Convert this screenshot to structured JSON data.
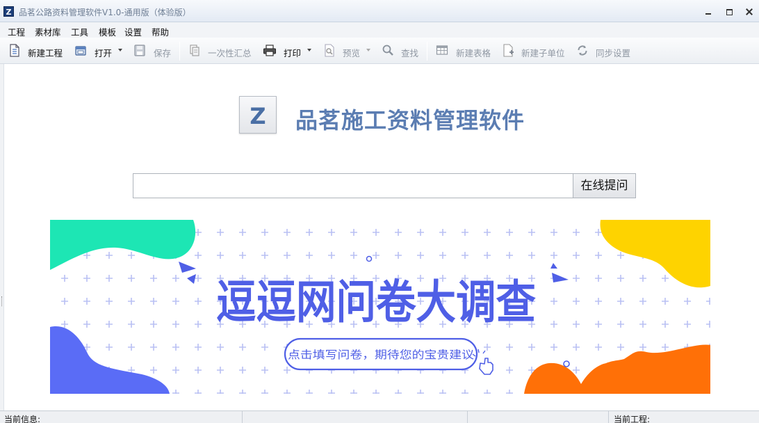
{
  "window": {
    "title": "品茗公路资料管理软件V1.0-通用版（体验版）",
    "app_icon_letter": "Z"
  },
  "menu": [
    "工程",
    "素材库",
    "工具",
    "模板",
    "设置",
    "帮助"
  ],
  "toolbar": {
    "new_project": "新建工程",
    "open": "打开",
    "save": "保存",
    "summary": "一次性汇总",
    "print": "打印",
    "preview": "预览",
    "find": "查找",
    "new_table": "新建表格",
    "new_subunit": "新建子单位",
    "sync_settings": "同步设置"
  },
  "main": {
    "logo_letter": "Z",
    "brand_title": "品茗施工资料管理软件",
    "search": {
      "value": "",
      "placeholder": ""
    },
    "ask_button": "在线提问"
  },
  "banner": {
    "headline": "逗逗网问卷大调查",
    "cta": "点击填写问卷，期待您的宝贵建议",
    "colors": {
      "teal": "#1de6b4",
      "yellow": "#fed300",
      "blue": "#5a6cf6",
      "orange": "#ff7007",
      "headline": "#4f5fe6",
      "plus": "#b9c0f4"
    }
  },
  "status": {
    "current_info": "当前信息:",
    "current_project": "当前工程:"
  }
}
